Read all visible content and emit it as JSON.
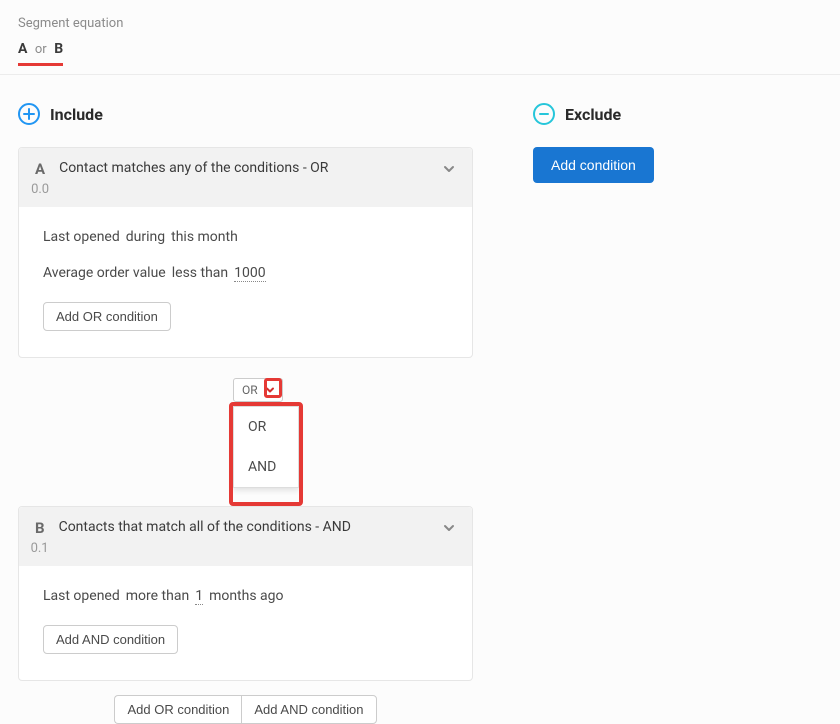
{
  "header": {
    "label": "Segment equation",
    "parts": {
      "a": "A",
      "or": "or",
      "b": "B"
    }
  },
  "include": {
    "title": "Include",
    "groups": [
      {
        "letter": "A",
        "title": "Contact matches any of the conditions - OR",
        "sub": "0.0",
        "conditions": [
          {
            "field": "Last opened",
            "op": "during",
            "value": "this month"
          },
          {
            "field": "Average order value",
            "op": "less than",
            "value": "1000"
          }
        ],
        "add_btn": "Add OR condition"
      },
      {
        "letter": "B",
        "title": "Contacts that match all of the conditions - AND",
        "sub": "0.1",
        "conditions": [
          {
            "field": "Last opened",
            "op": "more than",
            "value": "1",
            "suffix": "months ago"
          }
        ],
        "add_btn": "Add AND condition"
      }
    ],
    "joiner": {
      "current": "OR",
      "options": [
        "OR",
        "AND"
      ]
    },
    "bottom": {
      "add_or": "Add OR condition",
      "add_and": "Add AND condition"
    }
  },
  "exclude": {
    "title": "Exclude",
    "add_btn": "Add condition"
  }
}
